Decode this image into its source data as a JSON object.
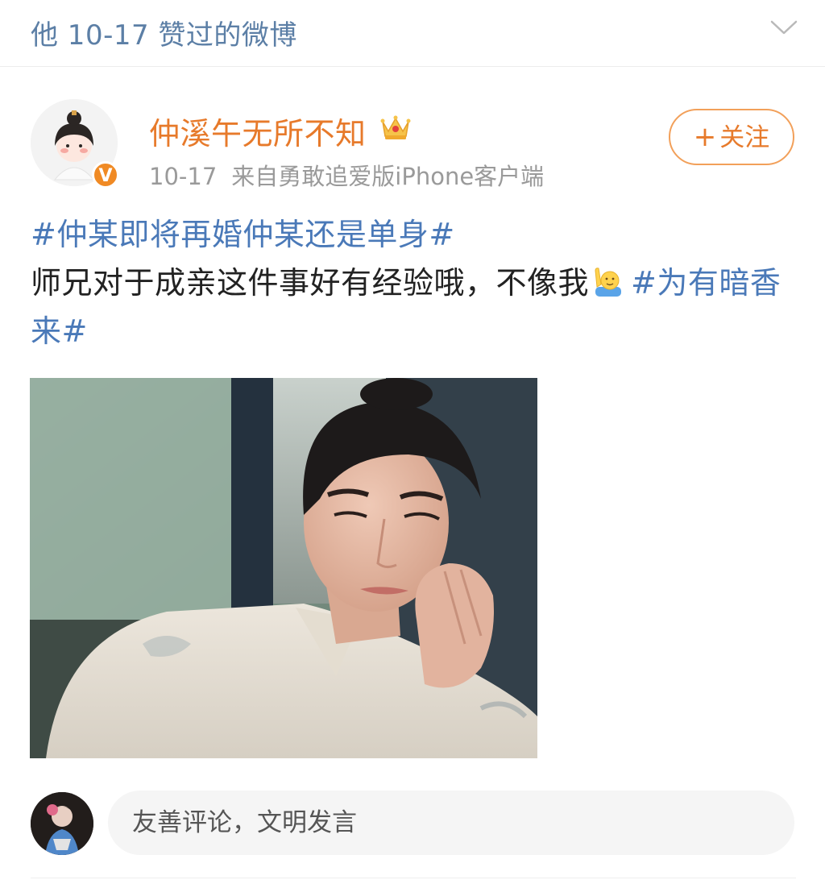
{
  "header": {
    "title": "他 10-17 赞过的微博",
    "chevron_icon": "chevron-down-icon"
  },
  "post": {
    "user": {
      "name": "仲溪午无所不知",
      "verified_badge": "V",
      "crown_icon": "crown-icon"
    },
    "meta": {
      "time": "10-17",
      "source": "来自勇敢追爱版iPhone客户端"
    },
    "follow_button": {
      "plus": "+",
      "label": "关注"
    },
    "text": {
      "hashtag1": "#仲某即将再婚仲某还是单身#",
      "body": "师兄对于成亲这件事好有经验哦，不像我",
      "emoji": "raising-hand-emoji-icon",
      "hashtag2": "#为有暗香来#"
    },
    "photo": "photo of a young man in light traditional robe, hand on cheek"
  },
  "comment": {
    "placeholder": "友善评论，文明发言"
  },
  "colors": {
    "hashtag": "#4a79b8",
    "username": "#e77a2b",
    "header_text": "#5c7fa6",
    "meta_text": "#9a9a9a"
  }
}
